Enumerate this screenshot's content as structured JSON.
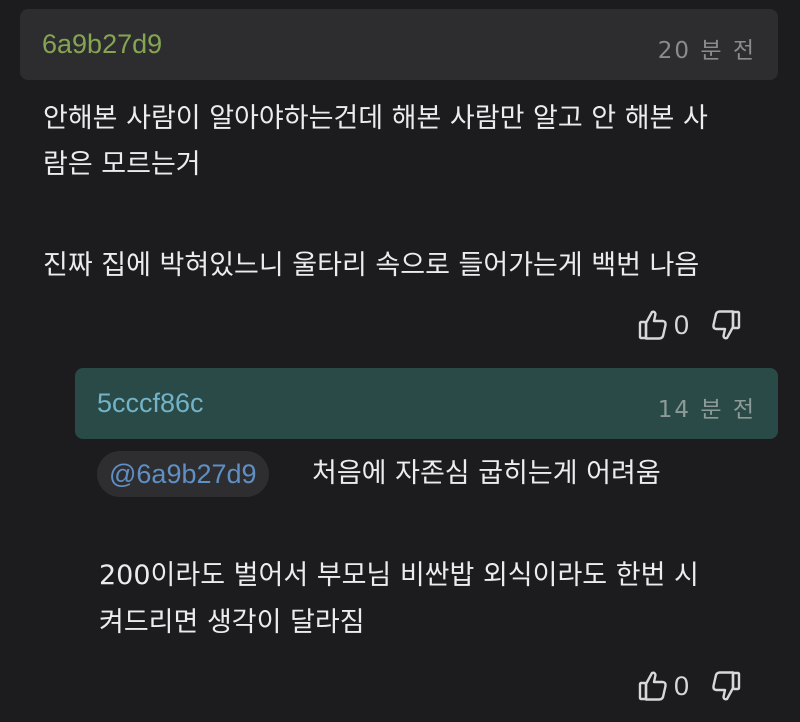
{
  "comments": [
    {
      "author": "6a9b27d9",
      "time": "20 분 전",
      "lines": [
        "안해본 사람이 알아야하는건데 해본 사람만 알고 안 해본 사",
        "람은 모르는거",
        "",
        "진짜 집에 박혀있느니 울타리 속으로 들어가는게 백번 나음"
      ],
      "likes": "0"
    },
    {
      "author": "5cccf86c",
      "time": "14 분 전",
      "mention": "@6a9b27d9",
      "lines": [
        "처음에 자존심 굽히는게 어려움",
        "",
        "200이라도 벌어서 부모님 비싼밥 외식이라도 한번 시",
        "켜드리면 생각이 달라짐"
      ],
      "likes": "0"
    }
  ],
  "icons": [
    "thumbs-up-icon",
    "thumbs-down-icon"
  ],
  "colors": {
    "background": "#1c1c1e",
    "header": "#2d2d2f",
    "reply_header": "#2a4a47",
    "author1": "#86a553",
    "author2": "#72b3c9",
    "mention": "#5f8fc4"
  }
}
